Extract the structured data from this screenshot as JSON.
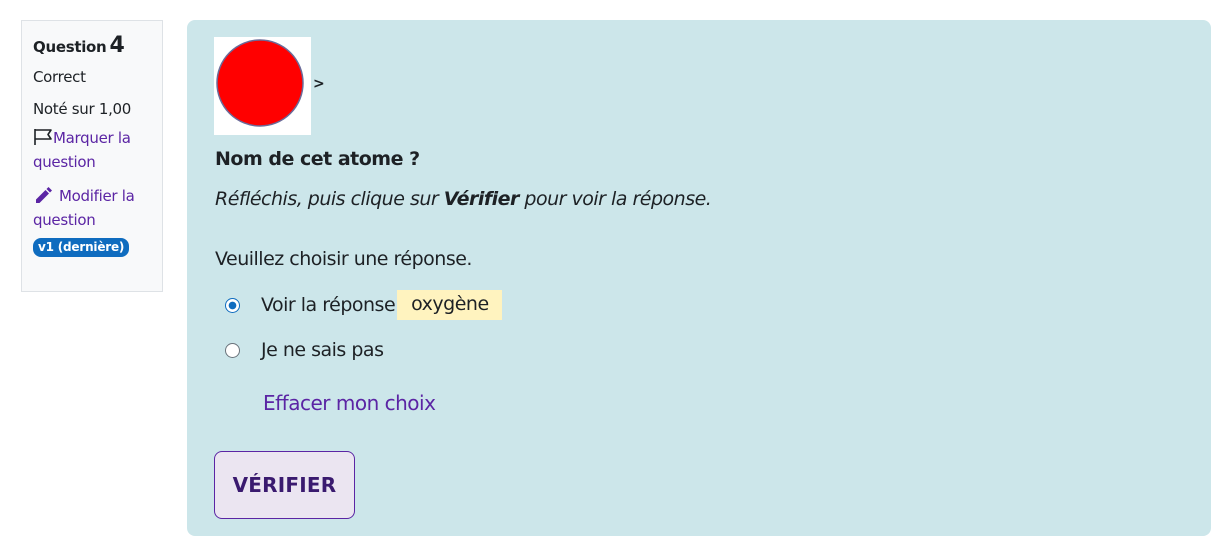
{
  "info": {
    "question_label": "Question",
    "question_number": "4",
    "state": "Correct",
    "grade": "Noté sur 1,00",
    "flag_label": "Marquer la question",
    "edit_label": "Modifier la question",
    "version_badge": "v1 (dernière)"
  },
  "question": {
    "arrow": ">",
    "title": "Nom de cet atome ?",
    "instruction_prefix": "Réfléchis, puis clique sur ",
    "instruction_bold": "Vérifier",
    "instruction_suffix": " pour voir la réponse.",
    "prompt": "Veuillez choisir une réponse.",
    "options": [
      {
        "label": "Voir la réponse",
        "answer": "oxygène",
        "selected": true
      },
      {
        "label": "Je ne sais pas",
        "selected": false
      }
    ],
    "clear_label": "Effacer mon choix",
    "check_label": "VÉRIFIER",
    "atom_color": "#ff0000"
  },
  "colors": {
    "accent": "#5b25a4",
    "badge": "#0f6cbf",
    "panel_bg": "#cce6ea",
    "answer_highlight": "#fff3bf"
  }
}
